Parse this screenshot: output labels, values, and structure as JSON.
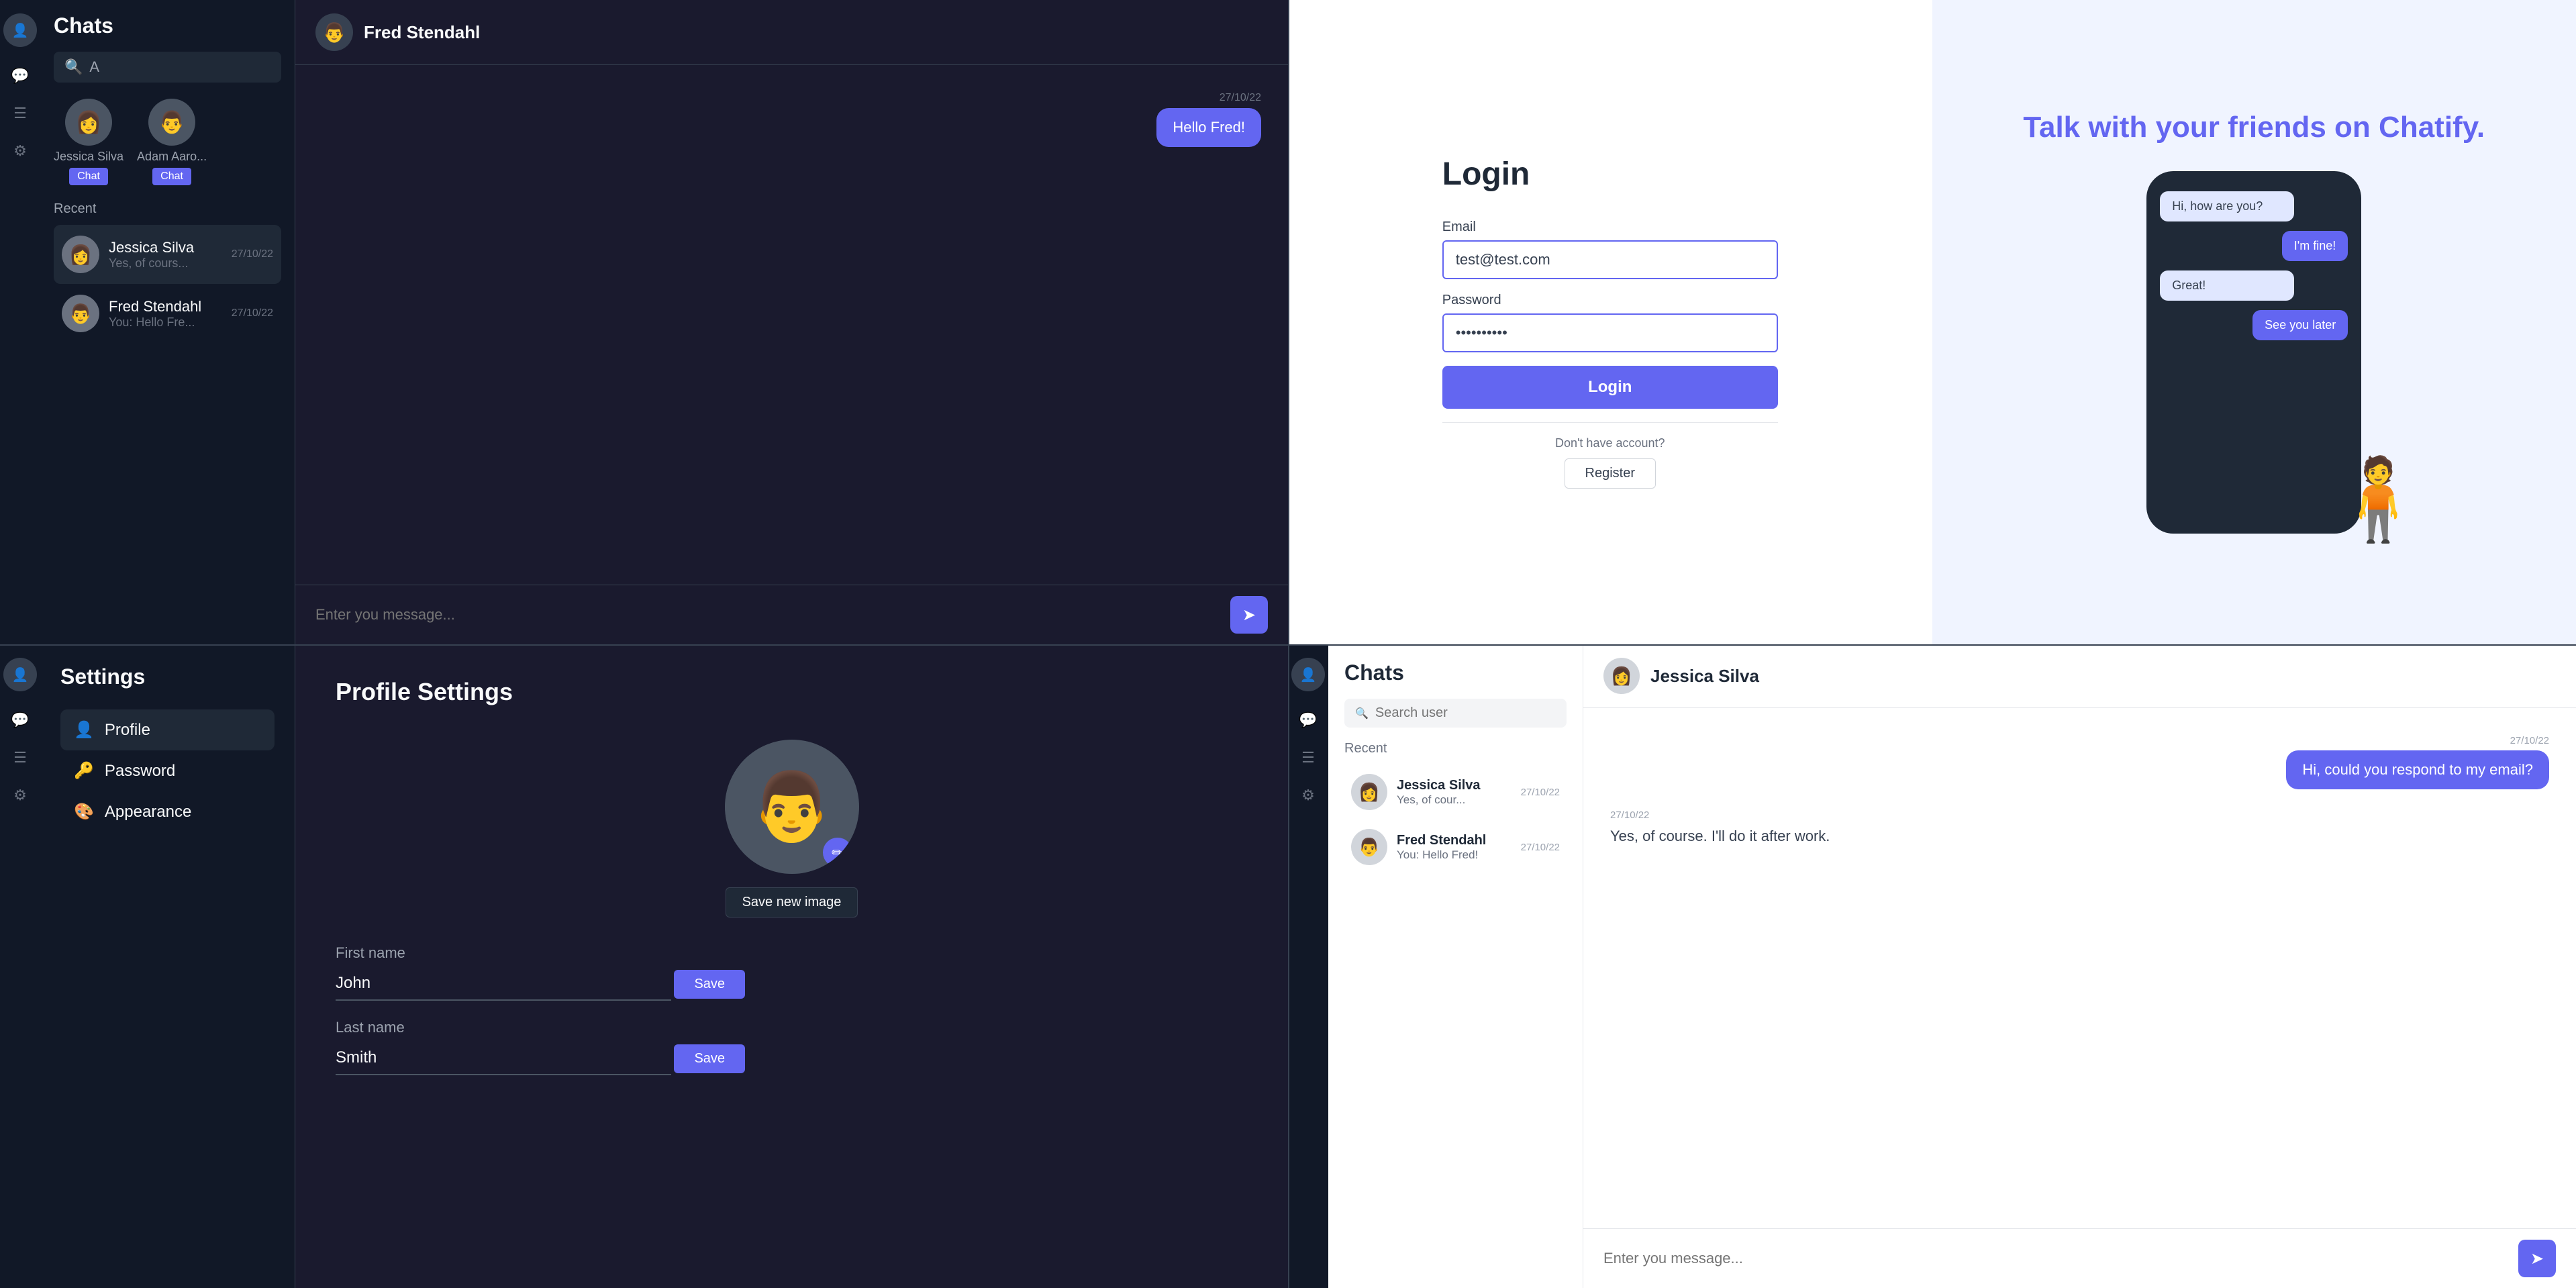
{
  "topLeft": {
    "appName": "Chats",
    "searchPlaceholder": "A",
    "stories": [
      {
        "name": "Jessica Silva",
        "btnLabel": "Chat"
      },
      {
        "name": "Adam Aaro...",
        "btnLabel": "Chat"
      }
    ],
    "recentLabel": "Recent",
    "chats": [
      {
        "name": "Jessica Silva",
        "preview": "Yes, of cours...",
        "time": "27/10/22"
      },
      {
        "name": "Fred Stendahl",
        "preview": "You: Hello Fre...",
        "time": "27/10/22"
      }
    ],
    "activeChat": {
      "name": "Fred Stendahl",
      "msgTime": "27/10/22",
      "msgText": "Hello Fred!",
      "inputPlaceholder": "Enter you message..."
    }
  },
  "topRight": {
    "loginTitle": "Login",
    "emailLabel": "Email",
    "emailValue": "test@test.com",
    "passwordLabel": "Password",
    "passwordValue": "••••••••••",
    "loginBtnLabel": "Login",
    "noAccountText": "Don't have account?",
    "registerBtnLabel": "Register",
    "heroTitle": "Talk with your friends on",
    "heroTitleBrand": "Chatify.",
    "phoneBubbles": [
      {
        "text": "Hi, how are you?",
        "side": "left"
      },
      {
        "text": "I'm fine!",
        "side": "right"
      },
      {
        "text": "Great!",
        "side": "left"
      },
      {
        "text": "See you later",
        "side": "right"
      }
    ]
  },
  "bottomLeft": {
    "settingsTitle": "Settings",
    "menuItems": [
      {
        "icon": "👤",
        "label": "Profile"
      },
      {
        "icon": "🔑",
        "label": "Password"
      },
      {
        "icon": "🎨",
        "label": "Appearance"
      }
    ],
    "profileSettingsTitle": "Profile Settings",
    "saveImageBtn": "Save new image",
    "firstNameLabel": "First name",
    "firstNameValue": "John",
    "lastNameLabel": "Last name",
    "lastNameValue": "Smith",
    "saveBtnLabel": "Save"
  },
  "bottomRight": {
    "chatsTitle": "Chats",
    "searchPlaceholder": "Search user",
    "recentLabel": "Recent",
    "chats": [
      {
        "name": "Jessica Silva",
        "preview": "Yes, of cour...",
        "time": "27/10/22"
      },
      {
        "name": "Fred Stendahl",
        "preview": "You: Hello Fred!",
        "time": "27/10/22"
      }
    ],
    "activeChat": {
      "name": "Jessica Silva",
      "msgTimeSent": "27/10/22",
      "msgSent": "Hi, could you respond to my email?",
      "msgTimeReceived": "27/10/22",
      "msgReceived": "Yes, of course. I'll do it after work.",
      "inputPlaceholder": "Enter you message..."
    }
  },
  "icons": {
    "chat": "💬",
    "list": "☰",
    "settings": "⚙",
    "send": "➤",
    "search": "🔍",
    "edit": "✏"
  }
}
